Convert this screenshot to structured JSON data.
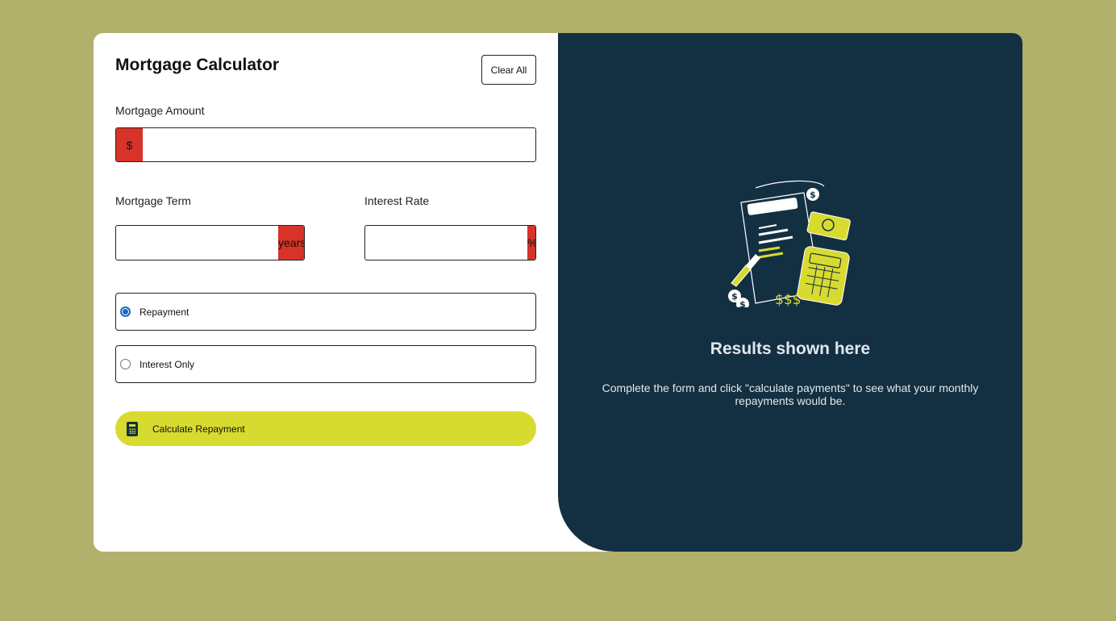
{
  "form": {
    "title": "Mortgage Calculator",
    "clear_label": "Clear All",
    "amount": {
      "label": "Mortgage Amount",
      "prefix": "$",
      "value": ""
    },
    "term": {
      "label": "Mortgage Term",
      "suffix": "years",
      "value": ""
    },
    "rate": {
      "label": "Interest Rate",
      "suffix": "%",
      "value": ""
    },
    "mortgage_type": {
      "options": [
        {
          "label": "Repayment",
          "checked": true
        },
        {
          "label": "Interest Only",
          "checked": false
        }
      ]
    },
    "calculate": {
      "label": "Calculate Repayment",
      "icon": "calculator-icon"
    }
  },
  "results": {
    "illustration": "empty-results-illustration",
    "title": "Results shown here",
    "description": "Complete the form and click \"calculate payments\" to see what your monthly repayments would be."
  },
  "colors": {
    "page_bg": "#b1b16c",
    "accent_lime": "#d8db2f",
    "error_red": "#d73328",
    "panel_dark": "#133042"
  }
}
